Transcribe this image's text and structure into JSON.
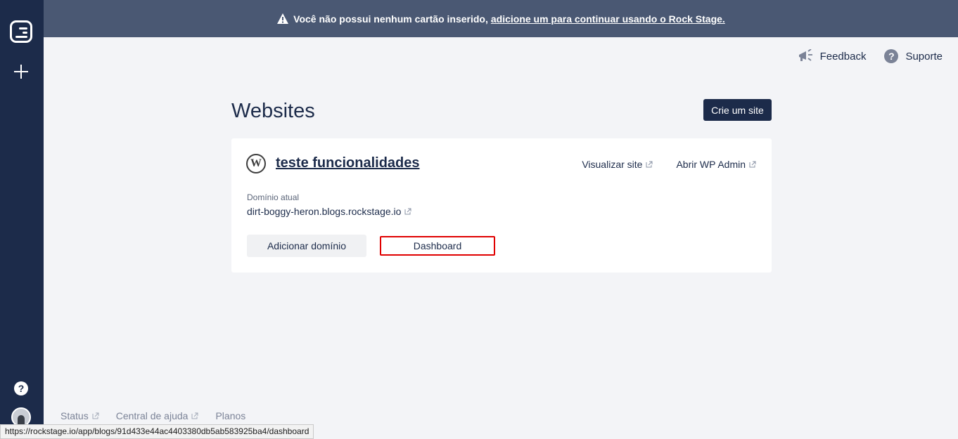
{
  "banner": {
    "message": "Você não possui nenhum cartão inserido,",
    "link": "adicione um para continuar usando o Rock Stage."
  },
  "topnav": {
    "feedback": "Feedback",
    "support": "Suporte"
  },
  "page": {
    "title": "Websites",
    "create_button": "Crie um site"
  },
  "site": {
    "name": "teste funcionalidades",
    "view_site": "Visualizar site",
    "open_wp_admin": "Abrir WP Admin",
    "domain_label": "Domínio atual",
    "domain_value": "dirt-boggy-heron.blogs.rockstage.io",
    "add_domain_button": "Adicionar domínio",
    "dashboard_button": "Dashboard"
  },
  "footer": {
    "status": "Status",
    "help_center": "Central de ajuda",
    "plans": "Planos"
  },
  "statusbar": {
    "url": "https://rockstage.io/app/blogs/91d433e44ac4403380db5ab583925ba4/dashboard"
  },
  "icons": {
    "logo": "rockstage-logo-icon",
    "add": "plus-icon",
    "help": "help-icon",
    "feedback": "megaphone-icon",
    "support": "question-icon",
    "wordpress": "wordpress-icon",
    "external": "external-link-icon"
  },
  "colors": {
    "sidebar": "#1c2b4a",
    "banner": "#4a5873",
    "primary_button": "#1c2b4a",
    "highlight_border": "#e00000",
    "background": "#f3f4f7"
  }
}
